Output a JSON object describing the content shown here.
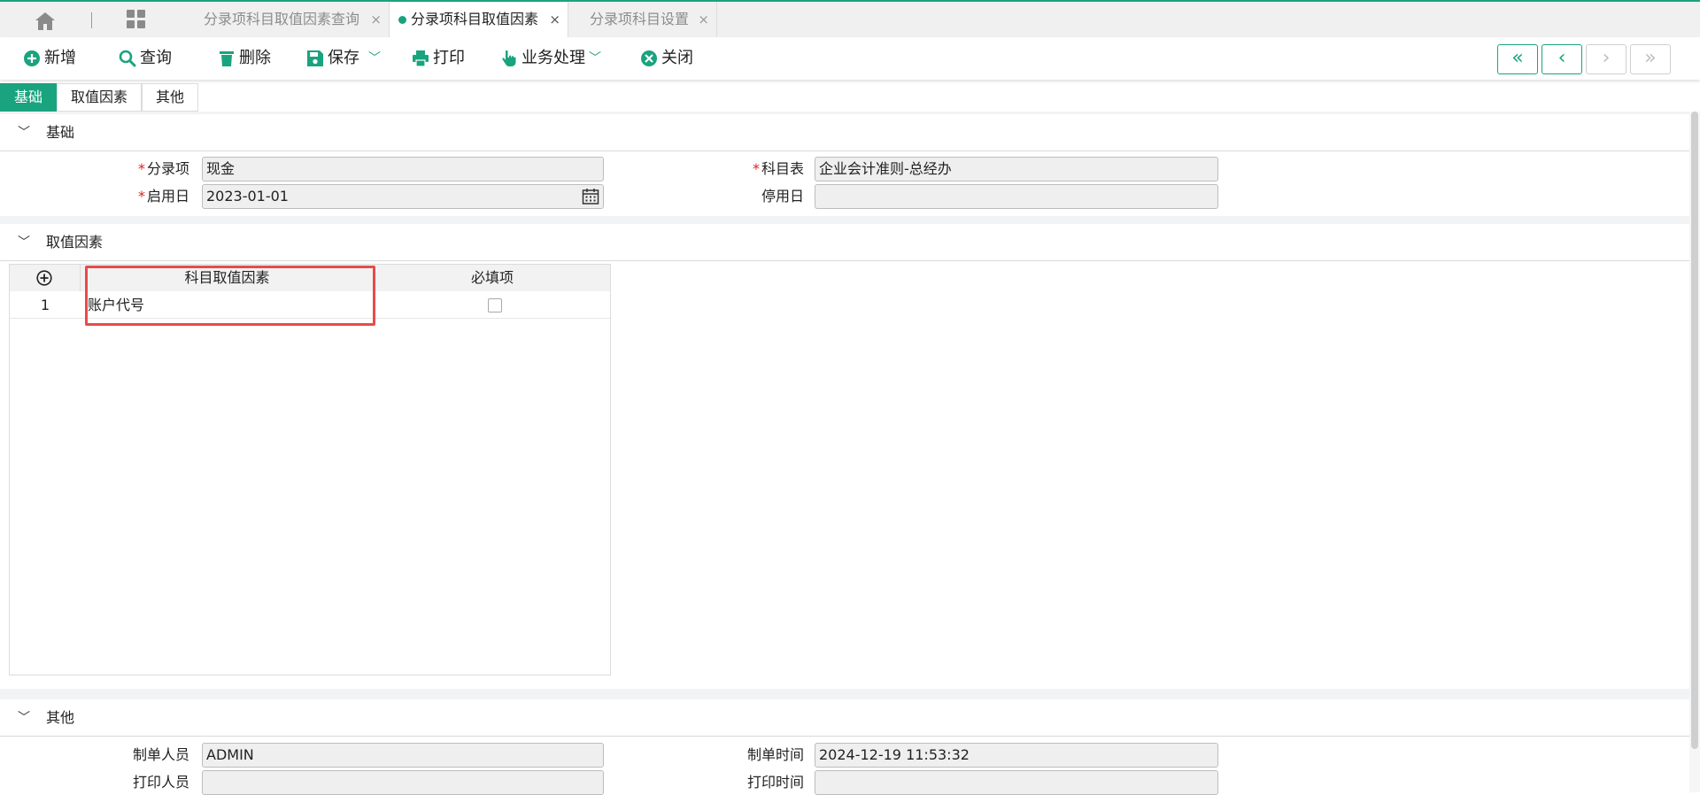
{
  "tabs": [
    {
      "label": "分录项科目取值因素查询",
      "active": false
    },
    {
      "label": "分录项科目取值因素",
      "active": true
    },
    {
      "label": "分录项科目设置",
      "active": false
    }
  ],
  "tab_close": "×",
  "toolbar": {
    "new_label": "新增",
    "query_label": "查询",
    "delete_label": "删除",
    "save_label": "保存",
    "print_label": "打印",
    "business_label": "业务处理",
    "close_label": "关闭"
  },
  "nav": {
    "first": "«",
    "prev": "‹",
    "next": "›",
    "last": "»"
  },
  "subtabs": [
    "基础",
    "取值因素",
    "其他"
  ],
  "basic": {
    "title": "基础",
    "entry_label": "分录项",
    "entry_value": "现金",
    "chart_label": "科目表",
    "chart_value": "企业会计准则-总经办",
    "start_label": "启用日",
    "start_value": "2023-01-01",
    "stop_label": "停用日",
    "stop_value": ""
  },
  "factors": {
    "title": "取值因素",
    "columns": [
      "科目取值因素",
      "必填项"
    ],
    "rows": [
      {
        "no": "1",
        "factor": "账户代号",
        "required": false
      }
    ]
  },
  "other": {
    "title": "其他",
    "creator_label": "制单人员",
    "creator_value": "ADMIN",
    "create_time_label": "制单时间",
    "create_time_value": "2024-12-19 11:53:32",
    "printer_label": "打印人员",
    "printer_value": "",
    "print_time_label": "打印时间",
    "print_time_value": ""
  },
  "required_mark": "*",
  "colors": {
    "accent": "#1aa37f",
    "highlight": "#e84b4b",
    "required": "#e02020"
  }
}
